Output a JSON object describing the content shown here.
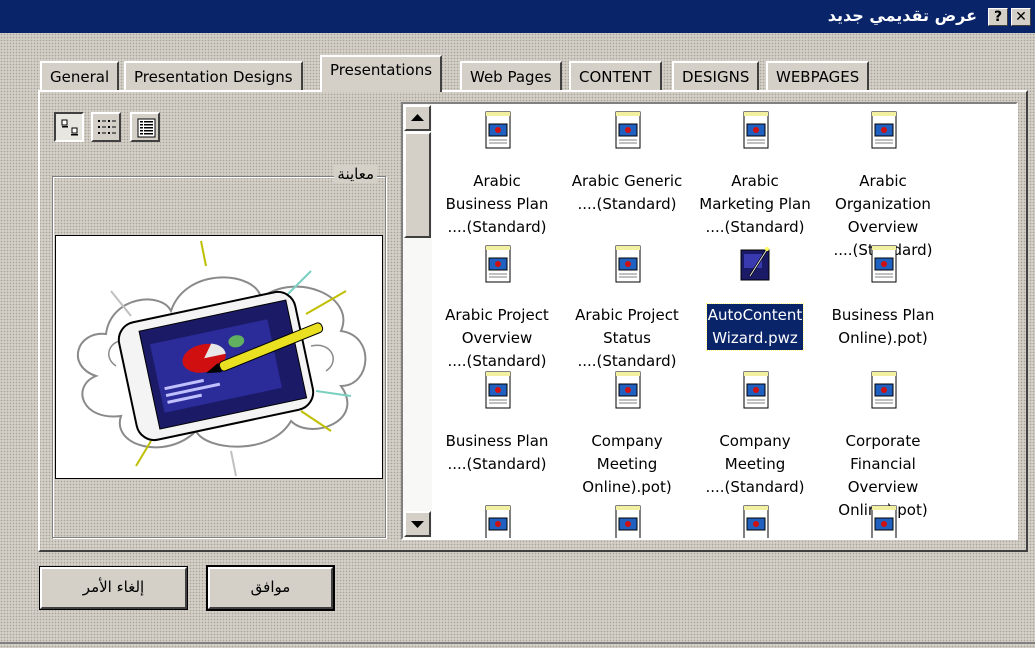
{
  "window": {
    "title": "عرض تقديمي جديد",
    "help_button": "?",
    "close_button": "✕"
  },
  "tabs": [
    {
      "label": "General",
      "active": false
    },
    {
      "label": "Presentation Designs",
      "active": false
    },
    {
      "label": "Presentations",
      "active": true
    },
    {
      "label": "Web Pages",
      "active": false
    },
    {
      "label": "CONTENT",
      "active": false
    },
    {
      "label": "DESIGNS",
      "active": false
    },
    {
      "label": "WEBPAGES",
      "active": false
    }
  ],
  "view_modes": {
    "selected": "large-icons",
    "options": [
      "large-icons",
      "list",
      "details"
    ]
  },
  "preview": {
    "label": "معاينة"
  },
  "files": [
    {
      "line1": "Arabic",
      "line2": "Business Plan",
      "line3": "....(Standard)",
      "icon": "template-icon"
    },
    {
      "line1": "Arabic Generic",
      "line2": "....(Standard)",
      "line3": "",
      "icon": "template-icon"
    },
    {
      "line1": "Arabic",
      "line2": "Marketing Plan",
      "line3": "....(Standard)",
      "icon": "template-icon"
    },
    {
      "line1": "Arabic",
      "line2": "Organization",
      "line3": "Overview",
      "line4": "....(Standard)",
      "icon": "template-icon"
    },
    {
      "line1": "Arabic Project",
      "line2": "Overview",
      "line3": "....(Standard)",
      "icon": "template-icon"
    },
    {
      "line1": "Arabic Project",
      "line2": "Status",
      "line3": "....(Standard)",
      "icon": "template-icon"
    },
    {
      "line1": "AutoContent",
      "line2": "Wizard.pwz",
      "line3": "",
      "icon": "wizard-icon",
      "selected": true
    },
    {
      "line1": "Business Plan",
      "line2": "Online).pot)",
      "line3": "",
      "icon": "template-icon"
    },
    {
      "line1": "Business Plan",
      "line2": "....(Standard)",
      "line3": "",
      "icon": "template-icon"
    },
    {
      "line1": "Company",
      "line2": "Meeting",
      "line3": "Online).pot)",
      "icon": "template-icon"
    },
    {
      "line1": "Company",
      "line2": "Meeting",
      "line3": "....(Standard)",
      "icon": "template-icon"
    },
    {
      "line1": "Corporate",
      "line2": "Financial",
      "line3": "Overview",
      "line4": "Online).pot)",
      "icon": "template-icon"
    }
  ],
  "buttons": {
    "ok": "موافق",
    "cancel": "إلغاء الأمر"
  },
  "colors": {
    "titlebar": "#0a246a",
    "face": "#d4d0c8",
    "selection": "#0a246a"
  }
}
